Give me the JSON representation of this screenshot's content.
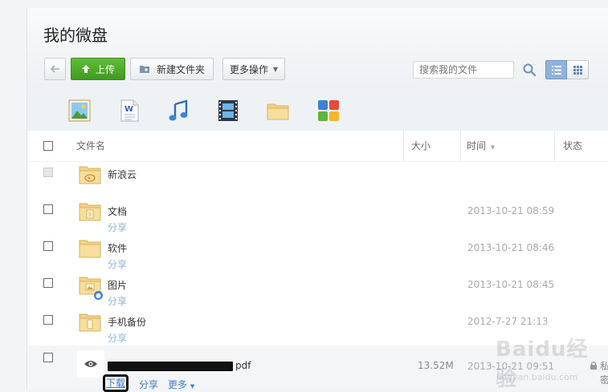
{
  "header": {
    "title": "我的微盘"
  },
  "toolbar": {
    "upload_label": "上传",
    "new_folder_label": "新建文件夹",
    "more_ops_label": "更多操作"
  },
  "search": {
    "placeholder": "搜索我的文件"
  },
  "view_modes": [
    "list",
    "grid"
  ],
  "type_filters": [
    "image-icon",
    "word-doc-icon",
    "music-icon",
    "video-icon",
    "folder-icon",
    "apps-icon"
  ],
  "table": {
    "headers": {
      "name": "文件名",
      "size": "大小",
      "time": "时间",
      "status": "状态"
    }
  },
  "rows": [
    {
      "name": "新浪云",
      "share": "",
      "date": "",
      "icon": "sina-cloud-folder-icon"
    },
    {
      "name": "文档",
      "share": "分享",
      "date": "2013-10-21 08:59",
      "icon": "document-folder-icon"
    },
    {
      "name": "软件",
      "share": "分享",
      "date": "2013-10-21 08:46",
      "icon": "folder-icon"
    },
    {
      "name": "图片",
      "share": "分享",
      "date": "2013-10-21 08:45",
      "icon": "picture-folder-icon"
    },
    {
      "name": "手机备份",
      "share": "分享",
      "date": "2012-7-27 21:13",
      "icon": "phone-backup-folder-icon"
    }
  ],
  "file_row": {
    "name_suffix": "pdf",
    "size": "13.52M",
    "date": "2013-10-21 09:51",
    "status": "私密",
    "actions": {
      "download": "下载",
      "share": "分享",
      "more": "更多"
    }
  },
  "watermark": {
    "text": "Baidu经验",
    "url": "jingyan.baidu.com"
  },
  "colors": {
    "upload_green": "#4aa825",
    "link_blue": "#3f7fc5",
    "share_blue": "#8fb3da",
    "folder_yellow": "#f3d27a"
  }
}
